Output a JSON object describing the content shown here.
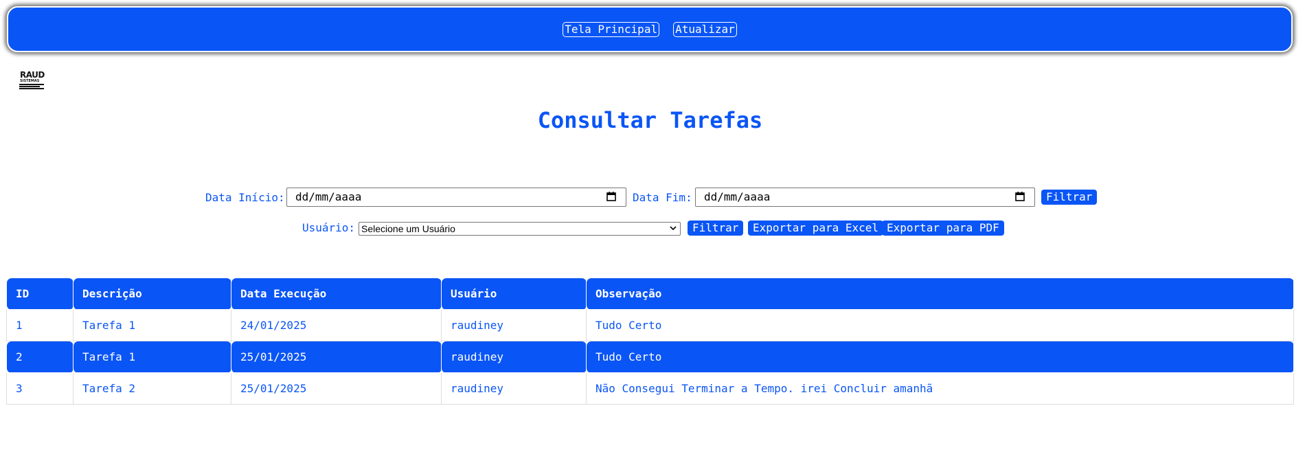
{
  "nav": {
    "home_label": "Tela Principal",
    "refresh_label": "Atualizar"
  },
  "logo": {
    "line1": "RAUD",
    "line2": "SISTEMAS"
  },
  "page": {
    "title": "Consultar Tarefas"
  },
  "filters": {
    "start_label": "Data Início:",
    "start_value": "dd/mm/aaaa",
    "end_label": "Data Fim:",
    "end_value": "dd/mm/aaaa",
    "filter_label": "Filtrar",
    "user_label": "Usuário:",
    "user_selected": "Selecione um Usuário",
    "user_filter_label": "Filtrar",
    "excel_label": "Exportar para Excel",
    "pdf_label": "Exportar para PDF"
  },
  "table": {
    "headers": [
      "ID",
      "Descrição",
      "Data Execução",
      "Usuário",
      "Observação"
    ],
    "rows": [
      [
        "1",
        "Tarefa 1",
        "24/01/2025",
        "raudiney",
        "Tudo Certo"
      ],
      [
        "2",
        "Tarefa 1",
        "25/01/2025",
        "raudiney",
        "Tudo Certo"
      ],
      [
        "3",
        "Tarefa 2",
        "25/01/2025",
        "raudiney",
        "Não Consegui Terminar a Tempo. irei Concluir amanhã"
      ]
    ]
  },
  "colors": {
    "accent": "#0a55f5",
    "background": "#ffffff"
  }
}
